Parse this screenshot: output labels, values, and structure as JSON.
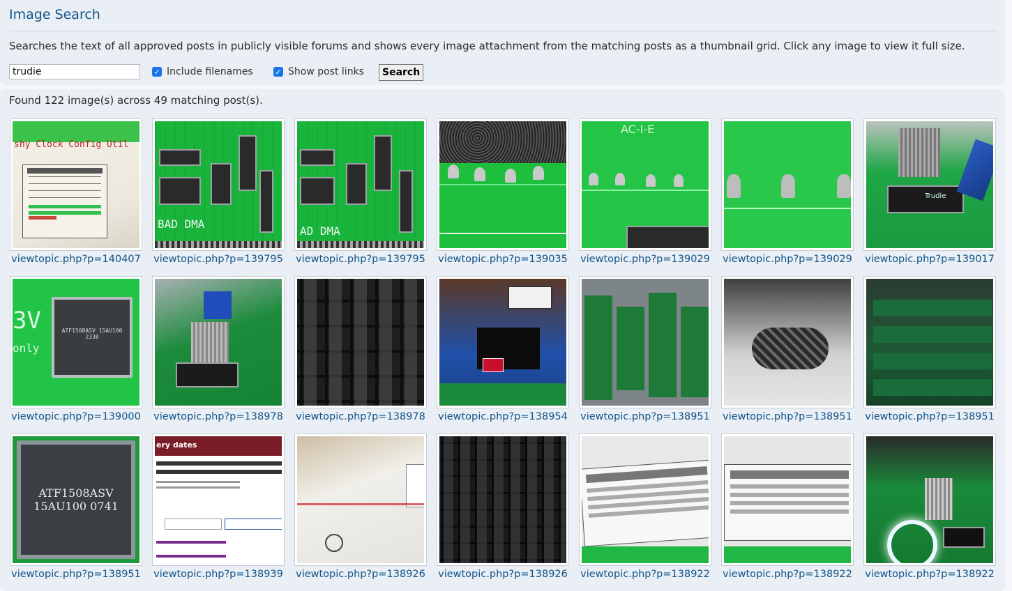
{
  "header": {
    "title": "Image Search",
    "description": "Searches the text of all approved posts in publicly visible forums and shows every image attachment from the matching posts as a thumbnail grid. Click any image to view it full size."
  },
  "search": {
    "value": "trudie",
    "include_filenames_label": "Include filenames",
    "include_filenames_checked": true,
    "show_post_links_label": "Show post links",
    "show_post_links_checked": true,
    "button_label": "Search"
  },
  "results": {
    "summary": "Found 122 image(s) across 49 matching post(s).",
    "items": [
      {
        "link": "viewtopic.php?p=140407",
        "thumb_text": "shy Clock Config Util"
      },
      {
        "link": "viewtopic.php?p=139795",
        "thumb_text": "BAD DMA"
      },
      {
        "link": "viewtopic.php?p=139795",
        "thumb_text": "AD DMA"
      },
      {
        "link": "viewtopic.php?p=139035",
        "thumb_text": ""
      },
      {
        "link": "viewtopic.php?p=139029",
        "thumb_text": "AC-I-E"
      },
      {
        "link": "viewtopic.php?p=139029",
        "thumb_text": ""
      },
      {
        "link": "viewtopic.php?p=139017",
        "thumb_text": "Trudie"
      },
      {
        "link": "viewtopic.php?p=139000",
        "thumb_text": "ATF1508ASV 15AU100 2338"
      },
      {
        "link": "viewtopic.php?p=138978",
        "thumb_text": ""
      },
      {
        "link": "viewtopic.php?p=138978",
        "thumb_text": ""
      },
      {
        "link": "viewtopic.php?p=138954",
        "thumb_text": ""
      },
      {
        "link": "viewtopic.php?p=138951",
        "thumb_text": ""
      },
      {
        "link": "viewtopic.php?p=138951",
        "thumb_text": ""
      },
      {
        "link": "viewtopic.php?p=138951",
        "thumb_text": ""
      },
      {
        "link": "viewtopic.php?p=138951",
        "thumb_text": "ATF1508ASV 15AU100 0741"
      },
      {
        "link": "viewtopic.php?p=138939",
        "thumb_text": "ery dates"
      },
      {
        "link": "viewtopic.php?p=138926",
        "thumb_text": ""
      },
      {
        "link": "viewtopic.php?p=138926",
        "thumb_text": ""
      },
      {
        "link": "viewtopic.php?p=138922",
        "thumb_text": ""
      },
      {
        "link": "viewtopic.php?p=138922",
        "thumb_text": ""
      },
      {
        "link": "viewtopic.php?p=138922",
        "thumb_text": ""
      }
    ]
  },
  "colors": {
    "accent": "#105289",
    "panel": "#e9eff4",
    "checkbox": "#1a73e8"
  }
}
